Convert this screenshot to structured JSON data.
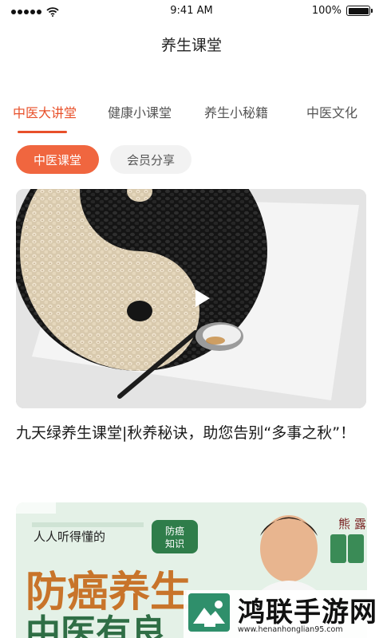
{
  "status_bar": {
    "time": "9:41 AM",
    "battery": "100%",
    "icons": [
      "signal-dots-icon",
      "wifi-icon",
      "battery-icon"
    ]
  },
  "header": {
    "title": "养生课堂"
  },
  "tabs": [
    {
      "label": "中医大讲堂",
      "active": true
    },
    {
      "label": "健康小课堂",
      "active": false
    },
    {
      "label": "养生小秘籍",
      "active": false
    },
    {
      "label": "中医文化",
      "active": false
    }
  ],
  "filters": [
    {
      "label": "中医课堂",
      "active": true
    },
    {
      "label": "会员分享",
      "active": false
    }
  ],
  "feed": [
    {
      "type": "video",
      "title": "九天绿养生课堂|秋养秘诀，助您告别“多事之秋”！",
      "image": "yin-yang bowl of job's tears and black beans with spoon",
      "icon": "play-icon"
    },
    {
      "type": "banner",
      "headline_small": "人人听得懂的",
      "badge": "防癌知识",
      "headline_large": "防癌养生",
      "headline_second": "中医有良",
      "image": "doctor portrait"
    }
  ],
  "watermark": {
    "name": "鸿联手游网",
    "url": "www.henanhonglian95.com"
  },
  "colors": {
    "accent": "#e8502a",
    "pill_active": "#f0663f",
    "pill_inactive": "#f2f2f2"
  }
}
